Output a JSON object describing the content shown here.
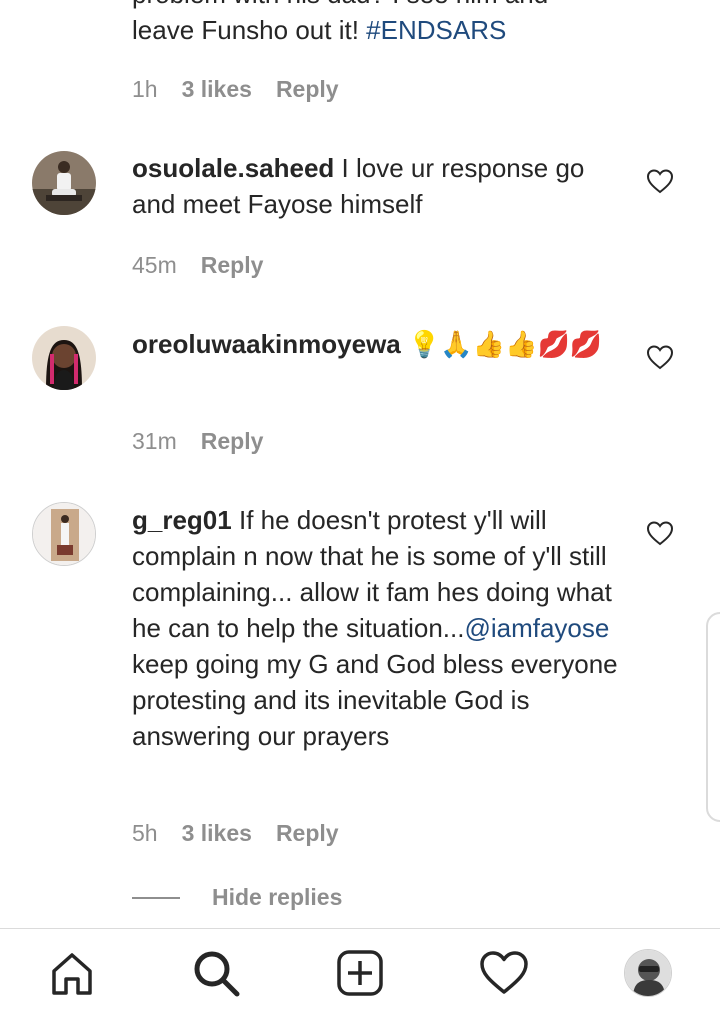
{
  "first_comment": {
    "text_line1": "problem with his dad? I see him and",
    "text_line2": "leave Funsho out it!",
    "hashtag": "#ENDSARS",
    "time": "1h",
    "likes": "3 likes",
    "reply": "Reply"
  },
  "comments": [
    {
      "username": "osuolale.saheed",
      "text": "I love ur response go and meet Fayose himself",
      "time": "45m",
      "reply": "Reply"
    },
    {
      "username": "oreoluwaakinmoyewa",
      "text": "💡🙏👍👍💋💋",
      "time": "31m",
      "reply": "Reply"
    },
    {
      "username": "g_reg01",
      "text_before": "If he doesn't protest y'll will complain n now that he is some of y'll still complaining... allow it fam hes doing what he can to help the situation...",
      "mention": "@iamfayose",
      "text_after": "keep going my G and God bless everyone protesting and its inevitable God is answering our prayers",
      "time": "5h",
      "likes": "3 likes",
      "reply": "Reply"
    }
  ],
  "hide_replies": "Hide replies",
  "nav": {
    "items": [
      "home-icon",
      "search-icon",
      "new-post-icon",
      "activity-heart-icon",
      "profile-avatar"
    ]
  },
  "colors": {
    "text": "#262626",
    "meta": "#8e8e8e",
    "link": "#1f4a7d",
    "divider": "#dbdbdb"
  }
}
